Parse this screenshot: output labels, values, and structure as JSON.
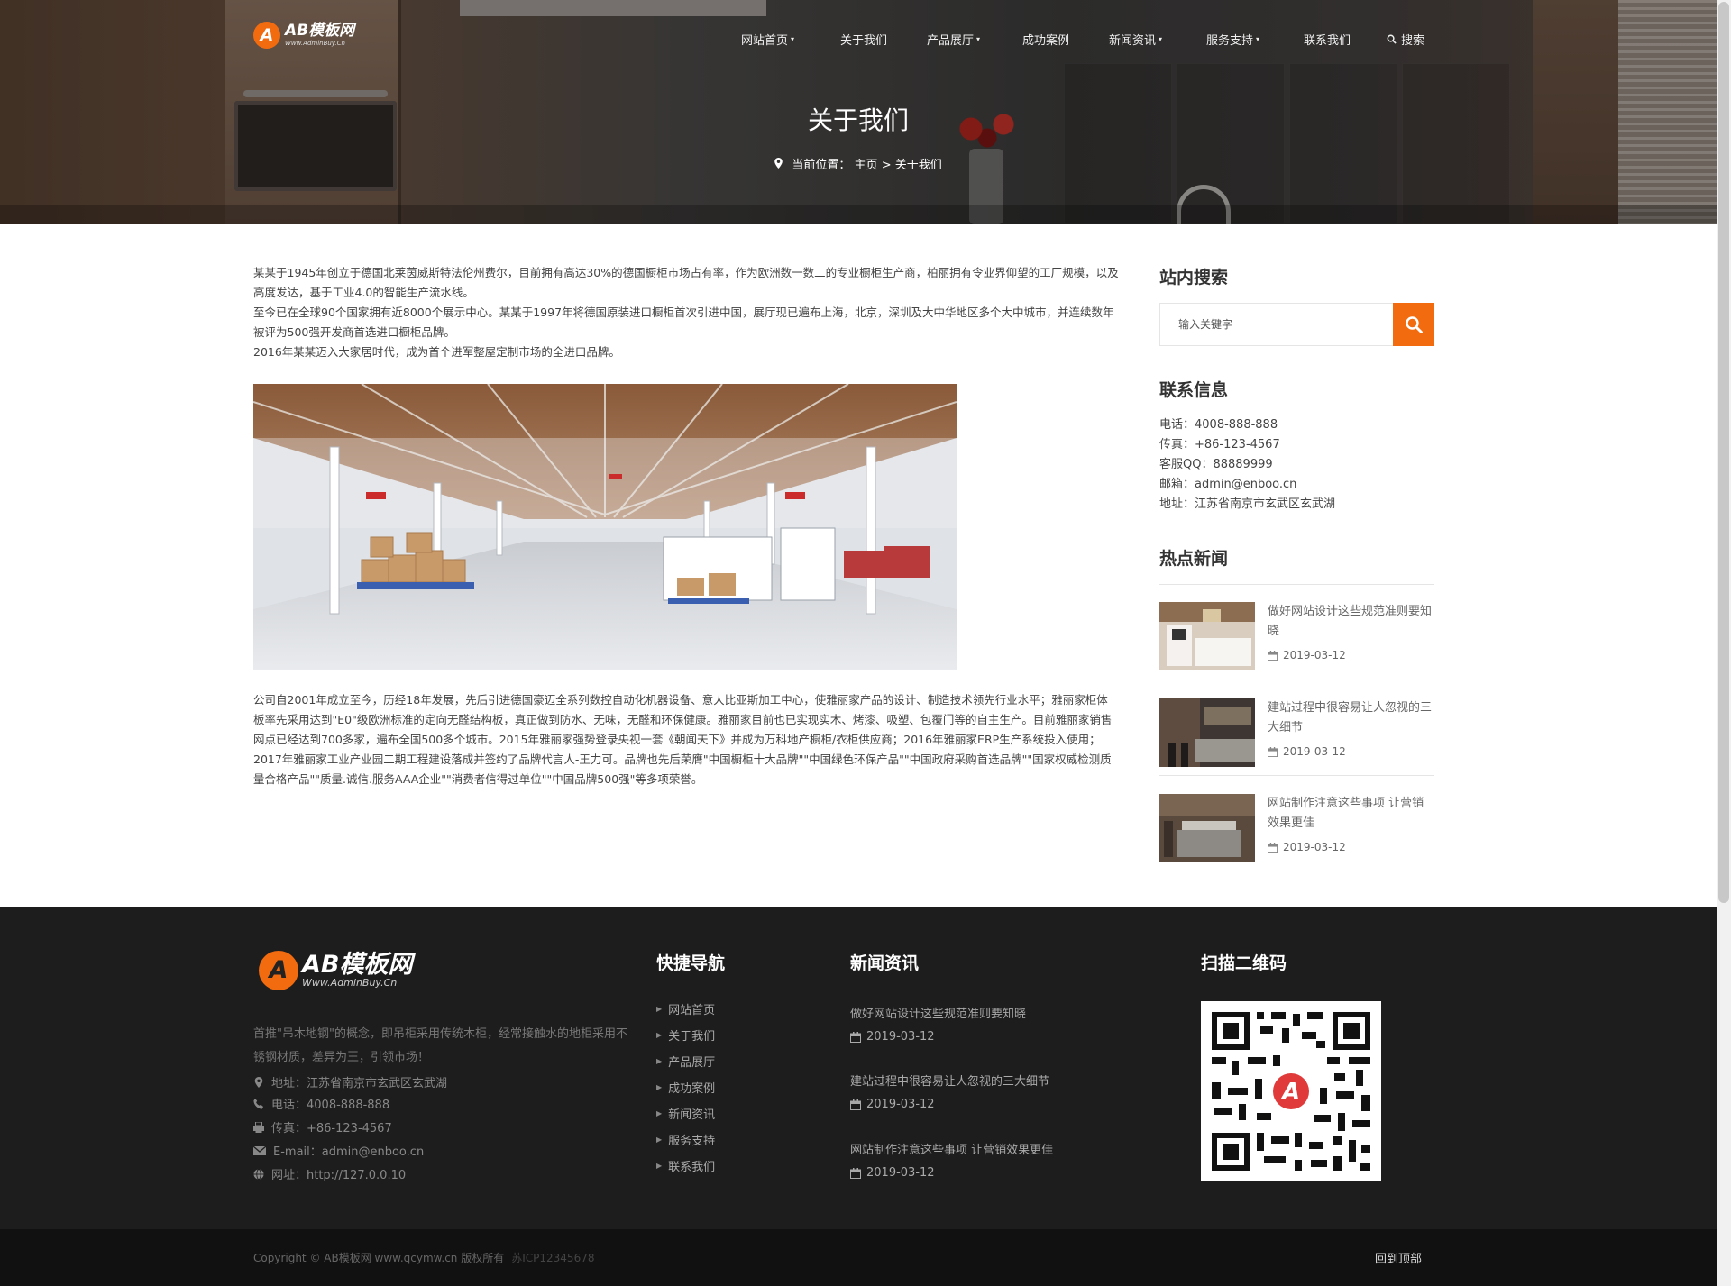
{
  "brand": {
    "logo_main": "AB模板网",
    "logo_sub": "Www.AdminBuy.Cn",
    "logo_letter": "A",
    "accent": "#f26b0f"
  },
  "nav": {
    "items": [
      {
        "label": "网站首页",
        "caret": "▾"
      },
      {
        "label": "关于我们",
        "caret": ""
      },
      {
        "label": "产品展厅",
        "caret": "▾"
      },
      {
        "label": "成功案例",
        "caret": ""
      },
      {
        "label": "新闻资讯",
        "caret": "▾"
      },
      {
        "label": "服务支持",
        "caret": "▾"
      },
      {
        "label": "联系我们",
        "caret": ""
      }
    ],
    "search_label": "搜索"
  },
  "hero": {
    "title": "关于我们",
    "breadcrumb_prefix": "当前位置：",
    "breadcrumb_home": "主页",
    "breadcrumb_sep": " > ",
    "breadcrumb_current": "关于我们"
  },
  "content": {
    "paragraphs_top": [
      "某某于1945年创立于德国北莱茵威斯特法伦州费尔，目前拥有高达30%的德国橱柜市场占有率，作为欧洲数一数二的专业橱柜生产商，柏丽拥有令业界仰望的工厂规模，以及高度发达，基于工业4.0的智能生产流水线。",
      "至今已在全球90个国家拥有近8000个展示中心。某某于1997年将德国原装进口橱柜首次引进中国，展厅现已遍布上海，北京，深圳及大中华地区多个大中城市，并连续数年被评为500强开发商首选进口橱柜品牌。",
      "2016年某某迈入大家居时代，成为首个进军整屋定制市场的全进口品牌。"
    ],
    "paragraph_bottom": "公司自2001年成立至今，历经18年发展，先后引进德国豪迈全系列数控自动化机器设备、意大比亚斯加工中心，使雅丽家产品的设计、制造技术领先行业水平；雅丽家柜体板率先采用达到\"E0\"级欧洲标准的定向无醛结构板，真正做到防水、无味，无醛和环保健康。雅丽家目前也已实现实木、烤漆、吸塑、包覆门等的自主生产。目前雅丽家销售网点已经达到700多家，遍布全国500多个城市。2015年雅丽家强势登录央视一套《朝闻天下》并成为万科地产橱柜/衣柜供应商；2016年雅丽家ERP生产系统投入使用；2017年雅丽家工业产业园二期工程建设落成并签约了品牌代言人-王力可。品牌也先后荣膺\"中国橱柜十大品牌\"\"中国绿色环保产品\"\"中国政府采购首选品牌\"\"国家权威检测质量合格产品\"\"质量.诚信.服务AAA企业\"\"消费者信得过单位\"\"中国品牌500强\"等多项荣誉。"
  },
  "sidebar": {
    "search_title": "站内搜索",
    "search_placeholder": "输入关键字",
    "contact_title": "联系信息",
    "contacts": [
      "电话：4008-888-888",
      "传真：+86-123-4567",
      "客服QQ：88889999",
      "邮箱：admin@enboo.cn",
      "地址：江苏省南京市玄武区玄武湖"
    ],
    "hot_title": "热点新闻",
    "hot_news": [
      {
        "title": "做好网站设计这些规范准则要知晓",
        "date": "2019-03-12"
      },
      {
        "title": "建站过程中很容易让人忽视的三大细节",
        "date": "2019-03-12"
      },
      {
        "title": "网站制作注意这些事项 让营销效果更佳",
        "date": "2019-03-12"
      }
    ]
  },
  "footer": {
    "about": "首推\"吊木地钢\"的概念，即吊柜采用传统木柜，经常接触水的地柜采用不锈钢材质，差异为王，引领市场！",
    "contacts": [
      {
        "icon": "map-marker-icon",
        "text": "地址：江苏省南京市玄武区玄武湖"
      },
      {
        "icon": "phone-icon",
        "text": "电话：4008-888-888"
      },
      {
        "icon": "fax-icon",
        "text": "传真：+86-123-4567"
      },
      {
        "icon": "envelope-icon",
        "text": "E-mail：admin@enboo.cn"
      },
      {
        "icon": "globe-icon",
        "text": "网址：http://127.0.0.10"
      }
    ],
    "quick_nav_title": "快捷导航",
    "quick_nav": [
      "网站首页",
      "关于我们",
      "产品展厅",
      "成功案例",
      "新闻资讯",
      "服务支持",
      "联系我们"
    ],
    "news_title": "新闻资讯",
    "news": [
      {
        "title": "做好网站设计这些规范准则要知晓",
        "date": "2019-03-12"
      },
      {
        "title": "建站过程中很容易让人忽视的三大细节",
        "date": "2019-03-12"
      },
      {
        "title": "网站制作注意这些事项 让营销效果更佳",
        "date": "2019-03-12"
      }
    ],
    "qr_title": "扫描二维码",
    "copyright": "Copyright © AB模板网 www.qcymw.cn 版权所有",
    "icp": "苏ICP12345678",
    "back_to_top": "回到顶部"
  }
}
